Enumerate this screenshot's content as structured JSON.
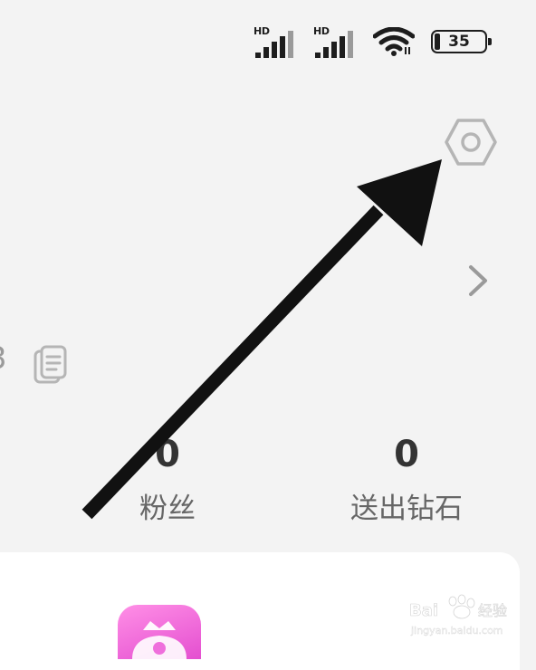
{
  "status_bar": {
    "signal_1_label": "HD",
    "signal_2_label": "HD",
    "wifi_icon": "wifi-icon",
    "battery_level": "35"
  },
  "profile": {
    "id_fragment": "3",
    "settings_icon": "gear-icon",
    "chevron_icon": "chevron-right-icon",
    "copy_icon": "copy-icon"
  },
  "stats": {
    "fans_value": "0",
    "fans_label": "粉丝",
    "diamonds_value": "0",
    "diamonds_label": "送出钻石"
  },
  "watermark": {
    "brand": "Baidu 经验",
    "url": "jingyan.baidu.com"
  },
  "colors": {
    "background": "#f3f3f3",
    "card": "#ffffff",
    "icon_gray": "#b5b5b5",
    "app_icon_pink": "#ef6fdc",
    "arrow": "#111111"
  }
}
